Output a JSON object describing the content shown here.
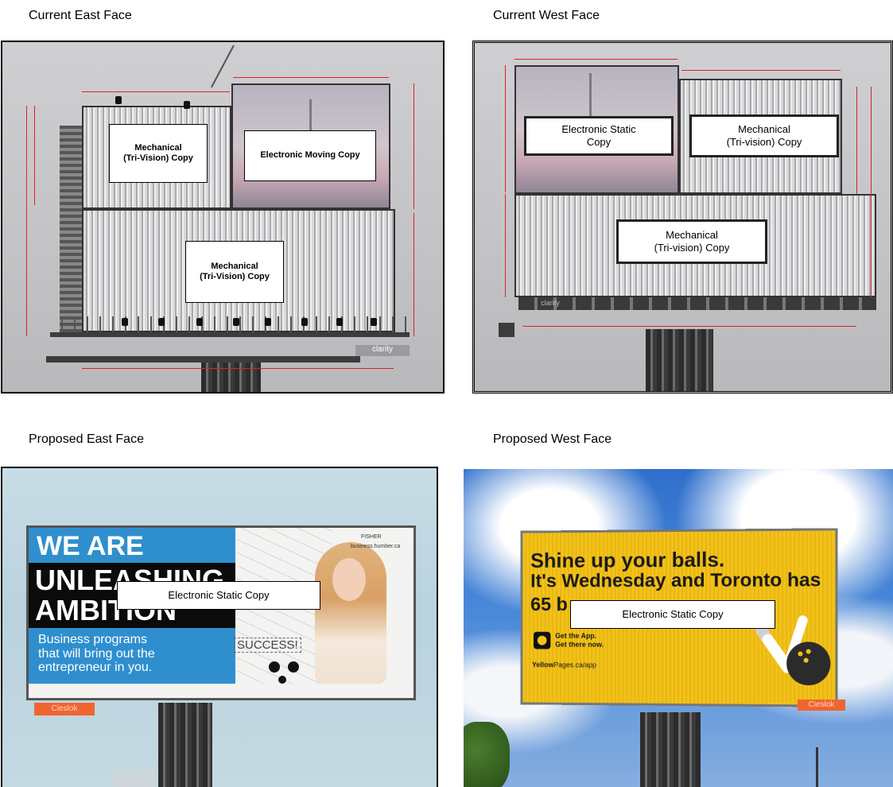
{
  "captions": {
    "current_east": "Current East Face",
    "current_west": "Current West Face",
    "proposed_east": "Proposed East Face",
    "proposed_west": "Proposed West Face"
  },
  "current_east": {
    "labels": {
      "top_left": "Mechanical\n(Tri-Vision) Copy",
      "top_right": "Electronic Moving Copy",
      "bottom": "Mechanical\n(Tri-Vision) Copy"
    },
    "brand": "clarity"
  },
  "current_west": {
    "labels": {
      "top_left": "Electronic Static\nCopy",
      "top_right": "Mechanical\n(Tri-vision) Copy",
      "bottom": "Mechanical\n(Tri-vision) Copy"
    },
    "brand": "clarity"
  },
  "proposed_east": {
    "label": "Electronic Static Copy",
    "ad": {
      "line1": "WE ARE",
      "line2": "UNLEASHING",
      "line3": "AMBITION",
      "body": "Business programs\nthat will bring out the\nentrepreneur in you.",
      "success": "SUCCESS!",
      "logo": "FISHER",
      "url": "business.humber.ca"
    },
    "brand": "Cieslok"
  },
  "proposed_west": {
    "label": "Electronic Static Copy",
    "ad": {
      "line1": "Shine up your balls.",
      "line2": "It's Wednesday and Toronto has",
      "line3": "65 b",
      "cta": "Get the App.\nGet there now.",
      "url_bold": "Yellow",
      "url_rest": "Pages.ca/app"
    },
    "brand": "Cieslok"
  },
  "colors": {
    "yellow_ad": "#f3c21a",
    "blue_ad": "#2f8fce",
    "dimension_red": "#dd2222"
  }
}
